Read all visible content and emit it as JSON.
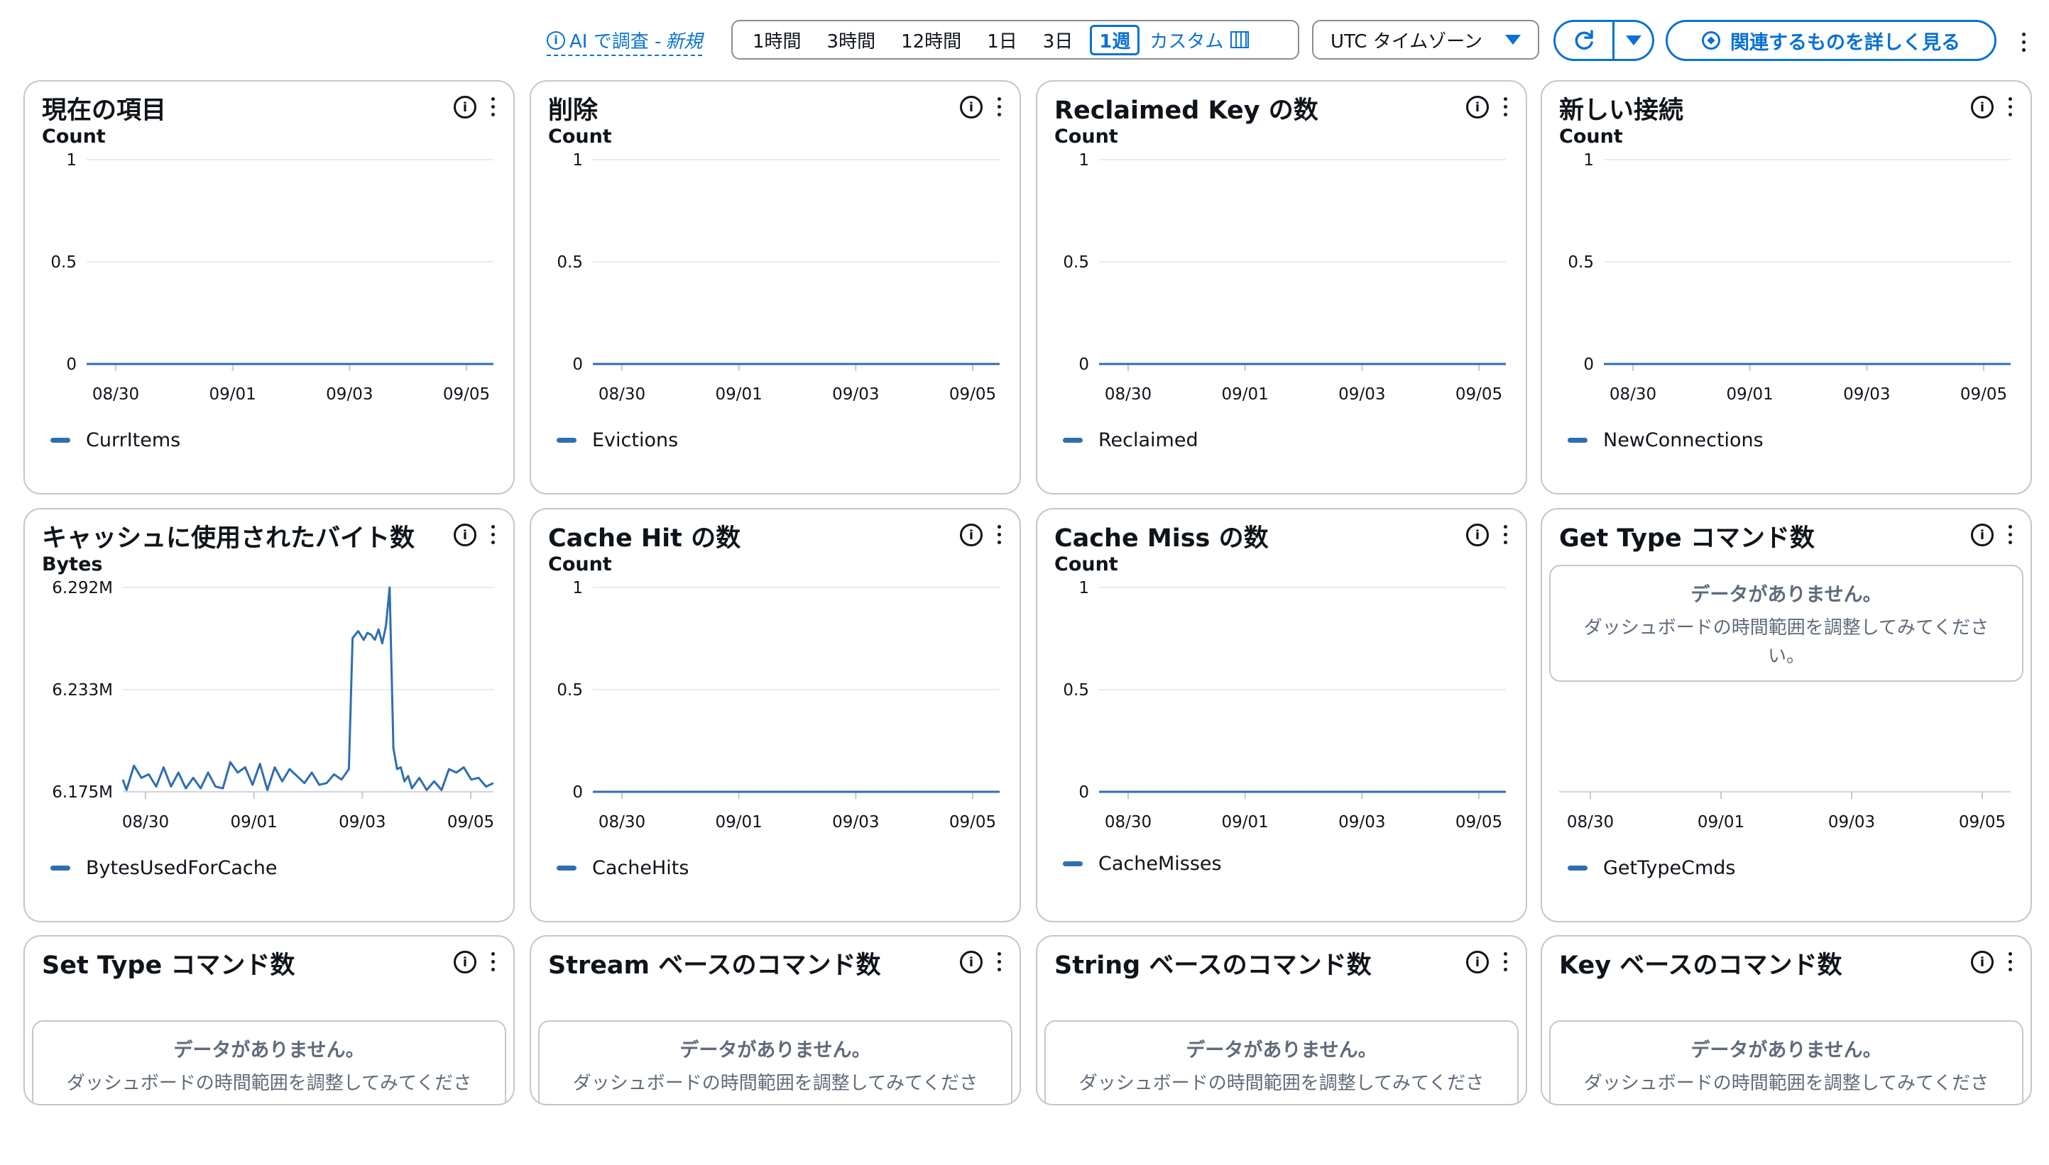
{
  "toolbar": {
    "ai_label": "AI で調査 -",
    "ai_new": "新規",
    "ranges": [
      "1時間",
      "3時間",
      "12時間",
      "1日",
      "3日",
      "1週"
    ],
    "selected_range": "1週",
    "custom_label": "カスタム",
    "timezone": "UTC タイムゾーン",
    "explore_label": "関連するものを詳しく見る"
  },
  "no_data": {
    "title": "データがありません。",
    "desc": "ダッシュボードの時間範囲を調整してみてください。"
  },
  "colors": {
    "accent": "#0972d3",
    "series": "#2e6fb0",
    "border": "#c6c6cd"
  },
  "widgets": [
    {
      "title": "現在の項目",
      "unit": "Count",
      "legend": "CurrItems"
    },
    {
      "title": "削除",
      "unit": "Count",
      "legend": "Evictions"
    },
    {
      "title": "Reclaimed Key の数",
      "unit": "Count",
      "legend": "Reclaimed"
    },
    {
      "title": "新しい接続",
      "unit": "Count",
      "legend": "NewConnections"
    },
    {
      "title": "キャッシュに使用されたバイト数",
      "unit": "Bytes",
      "legend": "BytesUsedForCache"
    },
    {
      "title": "Cache Hit の数",
      "unit": "Count",
      "legend": "CacheHits"
    },
    {
      "title": "Cache Miss の数",
      "unit": "Count",
      "legend": "CacheMisses"
    },
    {
      "title": "Get Type コマンド数",
      "unit": "",
      "legend": "GetTypeCmds"
    },
    {
      "title": "Set Type コマンド数",
      "unit": "",
      "legend": ""
    },
    {
      "title": "Stream ベースのコマンド数",
      "unit": "",
      "legend": ""
    },
    {
      "title": "String ベースのコマンド数",
      "unit": "",
      "legend": ""
    },
    {
      "title": "Key ベースのコマンド数",
      "unit": "",
      "legend": ""
    }
  ],
  "chart_data": [
    {
      "type": "line",
      "title": "現在の項目",
      "ylabel": "Count",
      "yticks": [
        "0",
        "0.5",
        "1"
      ],
      "ylim": [
        0,
        1
      ],
      "xticks": [
        "08/30",
        "09/01",
        "09/03",
        "09/05"
      ],
      "series": [
        {
          "name": "CurrItems",
          "x": [
            0,
            1
          ],
          "y": [
            0,
            0
          ]
        }
      ]
    },
    {
      "type": "line",
      "title": "削除",
      "ylabel": "Count",
      "yticks": [
        "0",
        "0.5",
        "1"
      ],
      "ylim": [
        0,
        1
      ],
      "xticks": [
        "08/30",
        "09/01",
        "09/03",
        "09/05"
      ],
      "series": [
        {
          "name": "Evictions",
          "x": [
            0,
            1
          ],
          "y": [
            0,
            0
          ]
        }
      ]
    },
    {
      "type": "line",
      "title": "Reclaimed Key の数",
      "ylabel": "Count",
      "yticks": [
        "0",
        "0.5",
        "1"
      ],
      "ylim": [
        0,
        1
      ],
      "xticks": [
        "08/30",
        "09/01",
        "09/03",
        "09/05"
      ],
      "series": [
        {
          "name": "Reclaimed",
          "x": [
            0,
            1
          ],
          "y": [
            0,
            0
          ]
        }
      ]
    },
    {
      "type": "line",
      "title": "新しい接続",
      "ylabel": "Count",
      "yticks": [
        "0",
        "0.5",
        "1"
      ],
      "ylim": [
        0,
        1
      ],
      "xticks": [
        "08/30",
        "09/01",
        "09/03",
        "09/05"
      ],
      "series": [
        {
          "name": "NewConnections",
          "x": [
            0,
            1
          ],
          "y": [
            0,
            0
          ]
        }
      ]
    },
    {
      "type": "line",
      "title": "キャッシュに使用されたバイト数",
      "ylabel": "Bytes",
      "yticks": [
        "6.175M",
        "6.233M",
        "6.292M"
      ],
      "ylim": [
        6.175,
        6.292
      ],
      "xticks": [
        "08/30",
        "09/01",
        "09/03",
        "09/05"
      ],
      "series": [
        {
          "name": "BytesUsedForCache",
          "x": [
            0,
            0.01,
            0.03,
            0.05,
            0.07,
            0.09,
            0.11,
            0.13,
            0.15,
            0.17,
            0.19,
            0.21,
            0.23,
            0.25,
            0.27,
            0.29,
            0.31,
            0.33,
            0.35,
            0.37,
            0.39,
            0.41,
            0.43,
            0.45,
            0.47,
            0.49,
            0.51,
            0.53,
            0.55,
            0.57,
            0.59,
            0.61,
            0.62,
            0.635,
            0.65,
            0.66,
            0.67,
            0.68,
            0.69,
            0.7,
            0.71,
            0.72,
            0.73,
            0.74,
            0.75,
            0.76,
            0.77,
            0.78,
            0.8,
            0.82,
            0.84,
            0.86,
            0.88,
            0.9,
            0.92,
            0.94,
            0.96,
            0.98,
            1.0
          ],
          "y": [
            6.182,
            6.176,
            6.19,
            6.183,
            6.185,
            6.178,
            6.189,
            6.178,
            6.186,
            6.177,
            6.183,
            6.177,
            6.186,
            6.178,
            6.177,
            6.192,
            6.186,
            6.189,
            6.179,
            6.191,
            6.176,
            6.189,
            6.181,
            6.188,
            6.184,
            6.18,
            6.186,
            6.179,
            6.18,
            6.185,
            6.182,
            6.188,
            6.263,
            6.267,
            6.262,
            6.266,
            6.265,
            6.262,
            6.268,
            6.26,
            6.27,
            6.292,
            6.2,
            6.188,
            6.189,
            6.181,
            6.184,
            6.177,
            6.183,
            6.176,
            6.181,
            6.176,
            6.188,
            6.186,
            6.189,
            6.182,
            6.183,
            6.178,
            6.18
          ]
        }
      ]
    },
    {
      "type": "line",
      "title": "Cache Hit の数",
      "ylabel": "Count",
      "yticks": [
        "0",
        "0.5",
        "1"
      ],
      "ylim": [
        0,
        1
      ],
      "xticks": [
        "08/30",
        "09/01",
        "09/03",
        "09/05"
      ],
      "series": [
        {
          "name": "CacheHits",
          "x": [
            0,
            1
          ],
          "y": [
            0,
            0
          ]
        }
      ]
    },
    {
      "type": "line",
      "title": "Cache Miss の数",
      "ylabel": "Count",
      "yticks": [
        "0",
        "0.5",
        "1"
      ],
      "ylim": [
        0,
        1
      ],
      "xticks": [
        "08/30",
        "09/01",
        "09/03",
        "09/05"
      ],
      "series": [
        {
          "name": "CacheMisses",
          "x": [
            0,
            1
          ],
          "y": [
            0,
            0
          ]
        }
      ]
    },
    {
      "type": "line",
      "title": "Get Type コマンド数",
      "xticks": [
        "08/30",
        "09/01",
        "09/03",
        "09/05"
      ],
      "series": [
        {
          "name": "GetTypeCmds",
          "x": [],
          "y": []
        }
      ]
    }
  ]
}
